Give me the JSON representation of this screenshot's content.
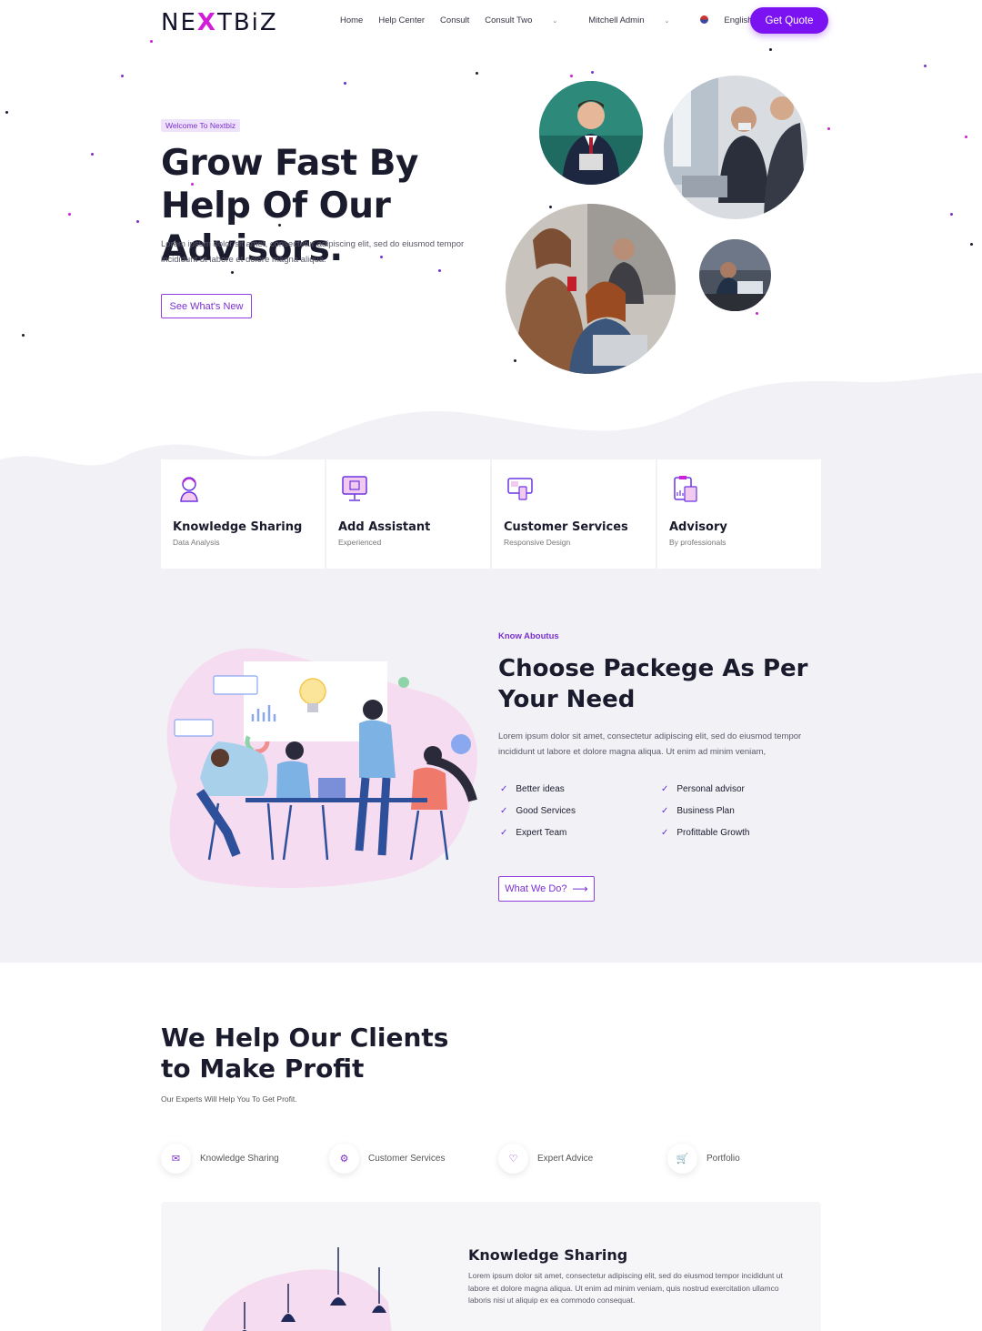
{
  "header": {
    "logo_prefix": "NE",
    "logo_x": "X",
    "logo_suffix": "TBiZ",
    "nav": [
      "Home",
      "Help Center",
      "Consult",
      "Consult Two"
    ],
    "user": "Mitchell Admin",
    "language": "English (US)",
    "cta": "Get Quote"
  },
  "hero": {
    "badge": "Welcome To Nextbiz",
    "title": "Grow Fast By Help Of Our Advisors.",
    "text": "Lorem ipsum dolor sit amet, consectetur adipiscing elit, sed do eiusmod tempor incididunt ut labore et dolore magna aliqua.",
    "button": "See What's New"
  },
  "services": [
    {
      "title": "Knowledge Sharing",
      "subtitle": "Data Analysis",
      "icon": "user-headset-icon"
    },
    {
      "title": "Add Assistant",
      "subtitle": "Experienced",
      "icon": "monitor-icon"
    },
    {
      "title": "Customer Services",
      "subtitle": "Responsive Design",
      "icon": "devices-icon"
    },
    {
      "title": "Advisory",
      "subtitle": "By professionals",
      "icon": "clipboard-icon"
    }
  ],
  "about": {
    "kicker": "Know Aboutus",
    "title": "Choose Packege As Per Your Need",
    "text": "Lorem ipsum dolor sit amet, consectetur adipiscing elit, sed do eiusmod tempor incididunt ut labore et dolore magna aliqua. Ut enim ad minim veniam,",
    "features_left": [
      "Better ideas",
      "Good Services",
      "Expert Team"
    ],
    "features_right": [
      "Personal advisor",
      "Business Plan",
      "Profittable Growth"
    ],
    "button": "What We Do?"
  },
  "profit": {
    "title": "We Help Our Clients to Make Profit",
    "subtitle": "Our Experts Will Help You To Get Profit.",
    "tabs": [
      {
        "label": "Knowledge Sharing",
        "icon": "envelope-icon"
      },
      {
        "label": "Customer Services",
        "icon": "gear-icon"
      },
      {
        "label": "Expert Advice",
        "icon": "heart-icon"
      },
      {
        "label": "Portfolio",
        "icon": "cart-icon"
      }
    ],
    "panel_title": "Knowledge Sharing",
    "panel_text": "Lorem ipsum dolor sit amet, consectetur adipiscing elit, sed do eiusmod tempor incididunt ut labore et dolore magna aliqua. Ut enim ad minim veniam, quis nostrud exercitation ullamco laboris nisi ut aliquip ex ea commodo consequat."
  },
  "colors": {
    "accent": "#7b12f2",
    "logo_x": "#d01fd6",
    "section_bg": "#f1f1f6"
  }
}
